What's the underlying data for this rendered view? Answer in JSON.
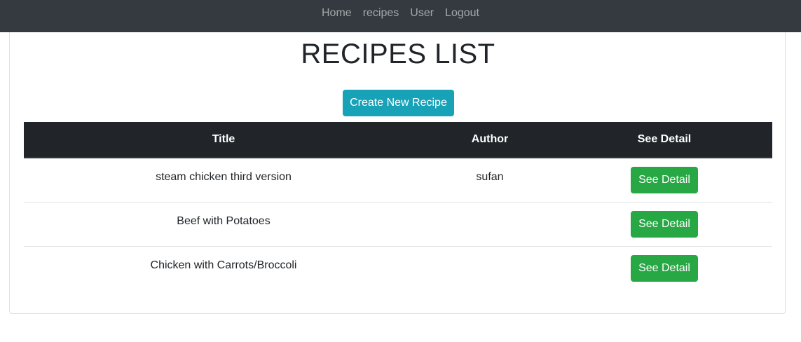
{
  "nav": {
    "links": [
      "Home",
      "recipes",
      "User",
      "Logout"
    ]
  },
  "page": {
    "title": "RECIPES LIST",
    "create_button": "Create New Recipe"
  },
  "table": {
    "headers": [
      "Title",
      "Author",
      "See Detail"
    ],
    "rows": [
      {
        "title": "steam chicken third version",
        "author": "sufan",
        "action": "See Detail"
      },
      {
        "title": "Beef with Potatoes",
        "author": "",
        "action": "See Detail"
      },
      {
        "title": "Chicken with Carrots/Broccoli",
        "author": "",
        "action": "See Detail"
      }
    ]
  },
  "colors": {
    "navbar": "#343a40",
    "table_header": "#212529",
    "info_button": "#17a2b8",
    "success_button": "#28a745"
  }
}
